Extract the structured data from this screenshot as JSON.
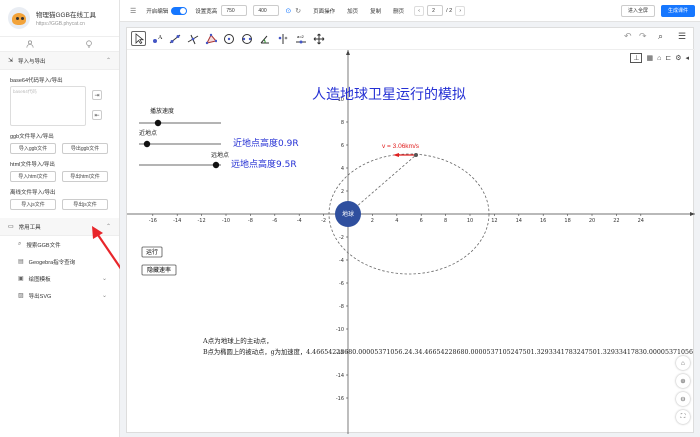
{
  "sidebar": {
    "title": "物理猫GGB在线工具",
    "url": "https://GGB.phycat.cn",
    "section_io": "导入与导出",
    "base64_label": "base64代码导入/导出",
    "base64_placeholder": "base64代码",
    "ggb_label": "ggb文件导入/导出",
    "ggb_import": "导入ggb文件",
    "ggb_export": "导出ggb文件",
    "html_label": "html文件导入/导出",
    "html_import": "导入html文件",
    "html_export": "导出html文件",
    "offline_label": "离线文件导入/导出",
    "js_import": "导入js文件",
    "js_export": "导出js文件",
    "section_tools": "常用工具",
    "tools": [
      "搜索GGB文件",
      "Geogebra指令查询",
      "绘图模板",
      "导出SVG"
    ]
  },
  "topbar": {
    "edit_label": "开启编辑",
    "size_label": "设置宽高",
    "width_value": "750",
    "height_value": "400",
    "page_ops_label": "页面操作",
    "add_page": "加页",
    "copy_page": "复制",
    "delete_page": "删页",
    "page_current": "2",
    "page_total": "/ 2",
    "fullscreen_button": "进入全屏",
    "generate_button": "生成课件"
  },
  "applet": {
    "title": "人造地球卫星运行的模拟",
    "slider_speed_label": "播放速度",
    "slider_perigee_label": "近地点",
    "slider_apogee_label": "远地点",
    "perigee_text": "近地点高度0.9R",
    "apogee_text": "远地点高度9.5R",
    "velocity_label": "v = 3.06km/s",
    "earth_label": "地球",
    "run_button": "运行",
    "hide_speed_button": "隐藏速率",
    "note_line1": "A点为地球上的主动点，",
    "note_line2": "B点为椭圆上的被动点，g为加速度，4.46654228680.00005371056.24.34.46654228680.0000537105247501.3293341783247501.32933417830.00005371056",
    "x_ticks": [
      "-16",
      "-14",
      "-12",
      "-10",
      "-8",
      "-6",
      "-4",
      "-2",
      "2",
      "4",
      "6",
      "8",
      "10",
      "12",
      "14",
      "16",
      "18",
      "20",
      "22",
      "24"
    ],
    "y_ticks": [
      "10",
      "8",
      "6",
      "4",
      "2",
      "-2",
      "-4",
      "-6",
      "-8",
      "-10",
      "-12",
      "-14",
      "-16"
    ],
    "accent_color": "#1677ff",
    "earth_color": "#2f4f9e"
  },
  "icons": {
    "sidebar_tabs": [
      "user-icon",
      "lightbulb-icon"
    ],
    "sidebar_tools": [
      "search-icon",
      "document-icon",
      "image-icon",
      "export-image-icon"
    ],
    "applet_tools": [
      "move-arrow-icon",
      "point-icon",
      "line-icon",
      "perpendicular-icon",
      "polygon-icon",
      "circle-icon",
      "ellipse-icon",
      "angle-icon",
      "reflect-icon",
      "slider-icon",
      "move-view-icon"
    ],
    "applet_right": [
      "undo-icon",
      "redo-icon",
      "search-icon",
      "menu-icon"
    ],
    "graph_tools": [
      "axes-icon",
      "grid-icon",
      "home-icon",
      "point-capture-icon",
      "settings-icon",
      "style-icon"
    ],
    "nav": [
      "home-icon",
      "zoom-in-icon",
      "zoom-out-icon",
      "fullscreen-icon"
    ]
  }
}
